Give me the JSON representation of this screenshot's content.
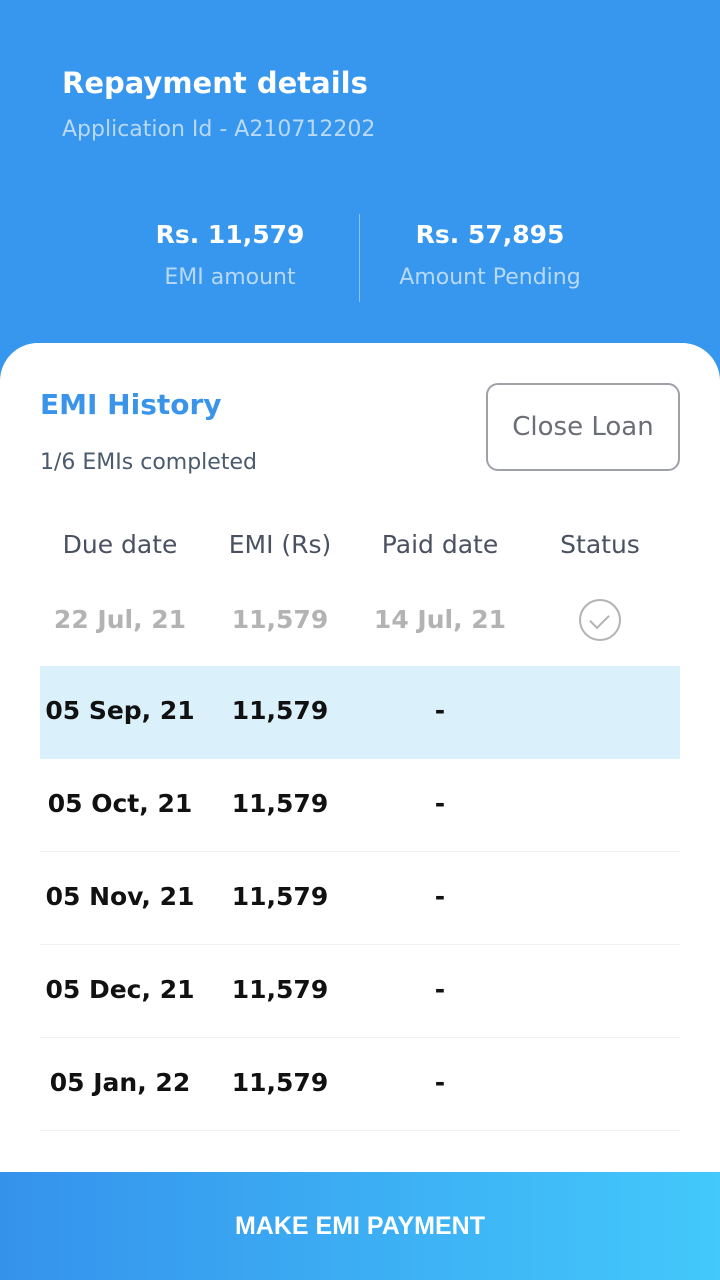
{
  "header": {
    "title": "Repayment details",
    "application_id": "Application Id - A210712202",
    "emi_amount_value": "Rs. 11,579",
    "emi_amount_label": "EMI amount",
    "amount_pending_value": "Rs. 57,895",
    "amount_pending_label": "Amount Pending"
  },
  "emi_history": {
    "title": "EMI History",
    "progress": "1/6 EMIs completed",
    "close_loan_label": "Close Loan",
    "columns": [
      "Due date",
      "EMI (Rs)",
      "Paid date",
      "Status"
    ],
    "rows": [
      {
        "due_date": "22 Jul, 21",
        "emi": "11,579",
        "paid_date": "14 Jul, 21",
        "status": "paid"
      },
      {
        "due_date": "05 Sep, 21",
        "emi": "11,579",
        "paid_date": "-",
        "status": ""
      },
      {
        "due_date": "05 Oct, 21",
        "emi": "11,579",
        "paid_date": "-",
        "status": ""
      },
      {
        "due_date": "05 Nov, 21",
        "emi": "11,579",
        "paid_date": "-",
        "status": ""
      },
      {
        "due_date": "05 Dec, 21",
        "emi": "11,579",
        "paid_date": "-",
        "status": ""
      },
      {
        "due_date": "05 Jan, 22",
        "emi": "11,579",
        "paid_date": "-",
        "status": ""
      }
    ]
  },
  "footer": {
    "pay_button_label": "MAKE EMI PAYMENT"
  },
  "colors": {
    "header_bg": "#3796ee",
    "accent": "#3a95ea",
    "highlight_row": "#daf0fb"
  },
  "icons": {
    "status_paid": "check-circle-icon"
  }
}
